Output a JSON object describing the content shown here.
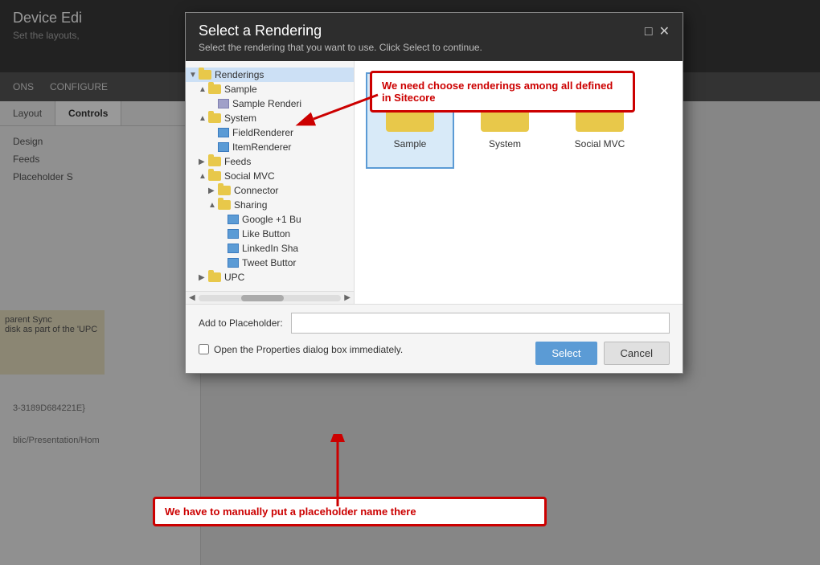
{
  "background": {
    "editor_title": "Device Edi",
    "editor_subtitle": "Set the layouts,",
    "nav_items": [
      "ONS",
      "CONFIGURE"
    ],
    "sidebar_tabs": [
      "Layout",
      "Controls"
    ],
    "sidebar_items": [
      "Design",
      "Feeds",
      "Placeholder S"
    ],
    "yellow_bar_text": "parent Sync\ndisk as part of the 'UPC",
    "guid_text": "3-3189D684221E}",
    "path_text": "blic/Presentation/Hom"
  },
  "modal": {
    "title": "Select a Rendering",
    "subtitle": "Select the rendering that you want to use. Click Select to continue.",
    "control_minimize": "□",
    "control_close": "✕",
    "tree": {
      "items": [
        {
          "id": "renderings",
          "label": "Renderings",
          "level": 0,
          "type": "folder",
          "expanded": true,
          "arrow": "▼",
          "selected": true
        },
        {
          "id": "sample",
          "label": "Sample",
          "level": 1,
          "type": "folder",
          "expanded": true,
          "arrow": "▲"
        },
        {
          "id": "sample-rendering",
          "label": "Sample Renderi",
          "level": 2,
          "type": "component",
          "arrow": ""
        },
        {
          "id": "system",
          "label": "System",
          "level": 1,
          "type": "folder",
          "expanded": true,
          "arrow": "▲"
        },
        {
          "id": "fieldrenderer",
          "label": "FieldRenderer",
          "level": 2,
          "type": "component",
          "arrow": ""
        },
        {
          "id": "itemrenderer",
          "label": "ItemRenderer",
          "level": 2,
          "type": "component",
          "arrow": ""
        },
        {
          "id": "feeds",
          "label": "Feeds",
          "level": 1,
          "type": "folder",
          "expanded": false,
          "arrow": "▶"
        },
        {
          "id": "social-mvc",
          "label": "Social MVC",
          "level": 1,
          "type": "folder",
          "expanded": true,
          "arrow": "▲"
        },
        {
          "id": "connector",
          "label": "Connector",
          "level": 2,
          "type": "folder",
          "expanded": false,
          "arrow": "▶"
        },
        {
          "id": "sharing",
          "label": "Sharing",
          "level": 2,
          "type": "folder",
          "expanded": true,
          "arrow": "▲"
        },
        {
          "id": "google1b",
          "label": "Google +1 Bu",
          "level": 3,
          "type": "component",
          "arrow": ""
        },
        {
          "id": "likebutton",
          "label": "Like Button",
          "level": 3,
          "type": "component",
          "arrow": ""
        },
        {
          "id": "linkedinsha",
          "label": "LinkedIn Sha",
          "level": 3,
          "type": "component",
          "arrow": ""
        },
        {
          "id": "tweetbutton",
          "label": "Tweet Buttor",
          "level": 3,
          "type": "component",
          "arrow": ""
        },
        {
          "id": "upc",
          "label": "UPC",
          "level": 1,
          "type": "folder",
          "expanded": false,
          "arrow": "▶"
        }
      ]
    },
    "content_folders": [
      {
        "id": "sample-folder",
        "label": "Sample",
        "selected": true
      },
      {
        "id": "system-folder",
        "label": "System",
        "selected": false
      },
      {
        "id": "social-mvc-folder",
        "label": "Social MVC",
        "selected": false
      }
    ],
    "footer": {
      "placeholder_label": "Add to Placeholder:",
      "placeholder_value": "",
      "placeholder_hint": "",
      "checkbox_label": "Open the Properties dialog box immediately.",
      "checkbox_checked": false,
      "btn_select": "Select",
      "btn_cancel": "Cancel"
    }
  },
  "callouts": {
    "top_text": "We need choose renderings among all defined in Sitecore",
    "bottom_text": "We have to manually put a placeholder name there"
  }
}
